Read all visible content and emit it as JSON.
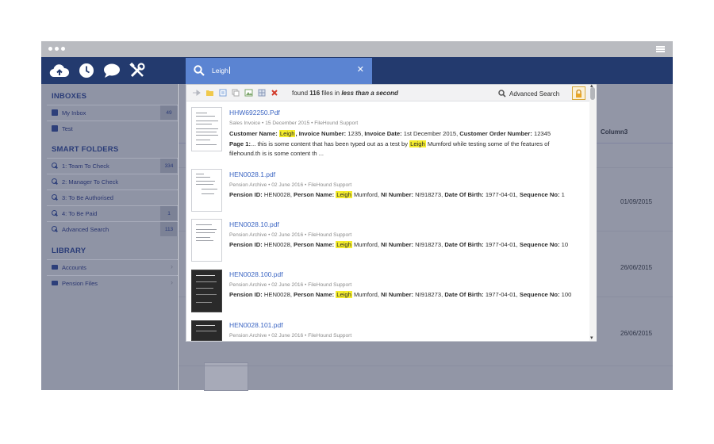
{
  "search": {
    "query": "Leigh",
    "found_prefix": "found",
    "found_count": "116",
    "found_mid": "files in",
    "found_time": "less than a second",
    "advanced_label": "Advanced Search"
  },
  "sidebar": {
    "inboxes_title": "INBOXES",
    "inboxes": [
      {
        "label": "My Inbox",
        "badge": "49"
      },
      {
        "label": "Test",
        "badge": ""
      }
    ],
    "smart_title": "SMART FOLDERS",
    "smart_folders": [
      {
        "label": "1: Team To Check",
        "badge": "334"
      },
      {
        "label": "2: Manager To Check",
        "badge": ""
      },
      {
        "label": "3: To Be Authorised",
        "badge": ""
      },
      {
        "label": "4: To Be Paid",
        "badge": "1"
      },
      {
        "label": "Advanced Search",
        "badge": "113"
      }
    ],
    "library_title": "LIBRARY",
    "library": [
      {
        "label": "Accounts"
      },
      {
        "label": "Pension Files"
      }
    ]
  },
  "table": {
    "column3": "Column3",
    "dates": [
      "01/09/2015",
      "26/06/2015",
      "26/06/2015"
    ]
  },
  "results": [
    {
      "title": "HHW692250.Pdf",
      "meta": "Sales Invoice • 15 December 2015 • FileHound Support",
      "l1_a": "Customer Name: ",
      "l1_hl": "Leigh",
      "l1_b": ", Invoice Number: ",
      "l1_c": "1235, ",
      "l1_d": "Invoice Date: ",
      "l1_e": "1st December 2015, ",
      "l1_f": "Customer Order Number: ",
      "l1_g": "12345",
      "l2_a": "Page 1:",
      "l2_b": "... this is some content that has been typed out as a test by ",
      "l2_hl": "Leigh",
      "l2_c": " Mumford while testing some of the features of",
      "l3": "filehound.th is is some content th ..."
    },
    {
      "title": "HEN0028.1.pdf",
      "meta": "Pension Archive • 02 June 2016 • FileHound Support",
      "p1": "Pension ID: ",
      "v1": "HEN0028, ",
      "p2": "Person Name: ",
      "hl": "Leigh",
      "v2": " Mumford, ",
      "p3": "NI Number: ",
      "v3": "NI918273, ",
      "p4": "Date Of Birth: ",
      "v4": "1977-04-01, ",
      "p5": "Sequence No: ",
      "v5": "1"
    },
    {
      "title": "HEN0028.10.pdf",
      "meta": "Pension Archive • 02 June 2016 • FileHound Support",
      "p1": "Pension ID: ",
      "v1": "HEN0028, ",
      "p2": "Person Name: ",
      "hl": "Leigh",
      "v2": " Mumford, ",
      "p3": "NI Number: ",
      "v3": "NI918273, ",
      "p4": "Date Of Birth: ",
      "v4": "1977-04-01, ",
      "p5": "Sequence No: ",
      "v5": "10"
    },
    {
      "title": "HEN0028.100.pdf",
      "meta": "Pension Archive • 02 June 2016 • FileHound Support",
      "p1": "Pension ID: ",
      "v1": "HEN0028, ",
      "p2": "Person Name: ",
      "hl": "Leigh",
      "v2": " Mumford, ",
      "p3": "NI Number: ",
      "v3": "NI918273, ",
      "p4": "Date Of Birth: ",
      "v4": "1977-04-01, ",
      "p5": "Sequence No: ",
      "v5": "100"
    },
    {
      "title": "HEN0028.101.pdf",
      "meta": "Pension Archive • 02 June 2016 • FileHound Support"
    }
  ],
  "icons": {
    "top": [
      "cloud-upload-icon",
      "clock-icon",
      "chat-bubble-icon",
      "tools-icon"
    ],
    "toolbar": [
      "pin-icon",
      "folder-icon",
      "document-icon",
      "copy-icon",
      "image-icon",
      "grid-icon",
      "delete-icon"
    ]
  },
  "colors": {
    "accent": "#5b84d2",
    "navbar": "#233a6e",
    "highlight": "#f4ec2c",
    "link": "#3a64c2"
  }
}
